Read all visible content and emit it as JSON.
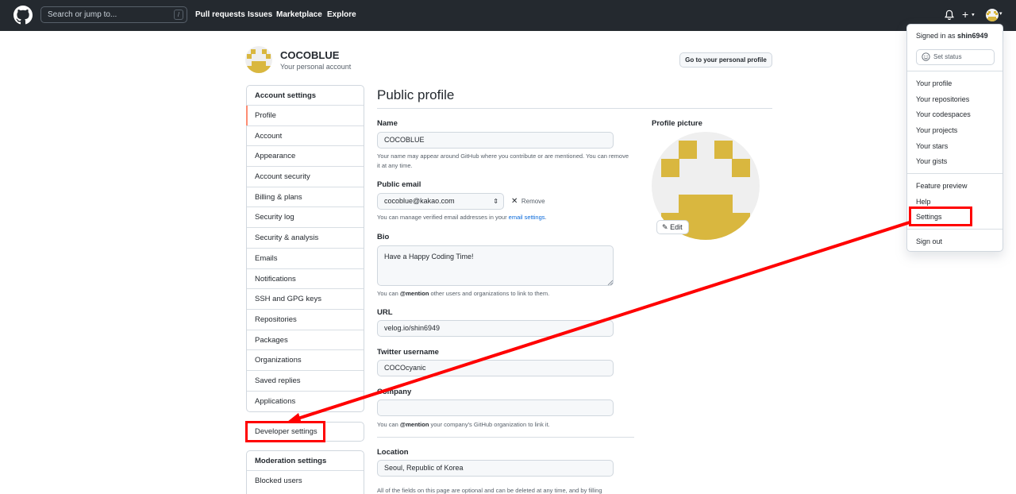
{
  "header": {
    "search_placeholder": "Search or jump to...",
    "search_shortcut": "/",
    "nav": [
      "Pull requests",
      "Issues",
      "Marketplace",
      "Explore"
    ],
    "plus_label": "+"
  },
  "account": {
    "name": "COCOBLUE",
    "subtitle": "Your personal account",
    "profile_button": "Go to your personal profile"
  },
  "sidebar": {
    "heading": "Account settings",
    "items": [
      "Profile",
      "Account",
      "Appearance",
      "Account security",
      "Billing & plans",
      "Security log",
      "Security & analysis",
      "Emails",
      "Notifications",
      "SSH and GPG keys",
      "Repositories",
      "Packages",
      "Organizations",
      "Saved replies",
      "Applications"
    ],
    "developer": "Developer settings",
    "moderation_heading": "Moderation settings",
    "moderation_items": [
      "Blocked users"
    ]
  },
  "main": {
    "title": "Public profile",
    "name_label": "Name",
    "name_value": "COCOBLUE",
    "name_note": "Your name may appear around GitHub where you contribute or are mentioned. You can remove it at any time.",
    "email_label": "Public email",
    "email_value": "cocoblue@kakao.com",
    "remove": "Remove",
    "email_note_pre": "You can manage verified email addresses in your ",
    "email_note_link": "email settings",
    "email_note_post": ".",
    "bio_label": "Bio",
    "bio_value": "Have a Happy Coding Time!",
    "mention_pre": "You can ",
    "mention_bold": "@mention",
    "bio_note_post": " other users and organizations to link to them.",
    "url_label": "URL",
    "url_value": "velog.io/shin6949",
    "twitter_label": "Twitter username",
    "twitter_value": "COCOcyanic",
    "company_label": "Company",
    "company_value": "",
    "company_note_post": " your company's GitHub organization to link it.",
    "location_label": "Location",
    "location_value": "Seoul, Republic of Korea",
    "footer_note": "All of the fields on this page are optional and can be deleted at any time, and by filling"
  },
  "picture": {
    "label": "Profile picture",
    "edit": "Edit"
  },
  "dropdown": {
    "signed_in_prefix": "Signed in as ",
    "username": "shin6949",
    "set_status": "Set status",
    "group1": [
      "Your profile",
      "Your repositories",
      "Your codespaces",
      "Your projects",
      "Your stars",
      "Your gists"
    ],
    "group2": [
      "Feature preview",
      "Help",
      "Settings"
    ],
    "sign_out": "Sign out"
  },
  "colors": {
    "header_bg": "#24292f",
    "annotation": "#ff0000",
    "avatar_yellow": "#d9b73f",
    "link": "#0969da"
  }
}
